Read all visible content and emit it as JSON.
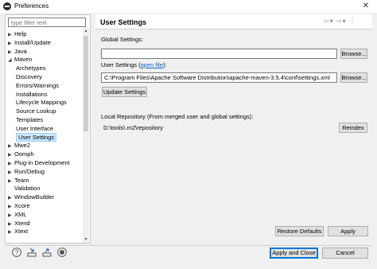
{
  "window": {
    "title": "Preferences",
    "close_glyph": "✕"
  },
  "filter": {
    "placeholder": "type filter text"
  },
  "tree": [
    {
      "label": "Help",
      "expander": "collapsed"
    },
    {
      "label": "Install/Update",
      "expander": "collapsed"
    },
    {
      "label": "Java",
      "expander": "collapsed"
    },
    {
      "label": "Maven",
      "expander": "expanded"
    },
    {
      "label": "Archetypes",
      "expander": "none"
    },
    {
      "label": "Discovery",
      "expander": "none"
    },
    {
      "label": "Errors/Warnings",
      "expander": "none"
    },
    {
      "label": "Installations",
      "expander": "none"
    },
    {
      "label": "Lifecycle Mappings",
      "expander": "none"
    },
    {
      "label": "Source Lookup",
      "expander": "none"
    },
    {
      "label": "Templates",
      "expander": "none"
    },
    {
      "label": "User Interface",
      "expander": "none"
    },
    {
      "label": "User Settings",
      "expander": "none",
      "selected": true
    },
    {
      "label": "Mwe2",
      "expander": "collapsed"
    },
    {
      "label": "Oomph",
      "expander": "collapsed"
    },
    {
      "label": "Plug-in Development",
      "expander": "collapsed"
    },
    {
      "label": "Run/Debug",
      "expander": "collapsed"
    },
    {
      "label": "Team",
      "expander": "collapsed"
    },
    {
      "label": "Validation",
      "expander": "none"
    },
    {
      "label": "WindowBuilder",
      "expander": "collapsed"
    },
    {
      "label": "Xcore",
      "expander": "collapsed"
    },
    {
      "label": "XML",
      "expander": "collapsed"
    },
    {
      "label": "Xtend",
      "expander": "collapsed"
    },
    {
      "label": "Xtext",
      "expander": "collapsed"
    }
  ],
  "page": {
    "title": "User Settings",
    "global_settings_label": "Global Settings:",
    "global_settings_value": "",
    "browse_label": "Browse...",
    "user_settings_label": "User Settings",
    "open_file_label": "open file",
    "user_settings_value": "C:\\Program Files\\Apache Software Distribution\\apache-maven-3.5.4\\conf\\settings.xml",
    "update_settings_label": "Update Settings",
    "local_repo_label": "Local Repository (From merged user and global settings):",
    "local_repo_value": "D:\\tools\\.m2\\repository",
    "reindex_label": "Reindex",
    "restore_defaults_label": "Restore Defaults",
    "apply_label": "Apply"
  },
  "footer": {
    "apply_close_label": "Apply and Close",
    "cancel_label": "Cancel"
  },
  "icons": [
    "help-icon",
    "import-icon",
    "export-icon",
    "record-icon"
  ]
}
